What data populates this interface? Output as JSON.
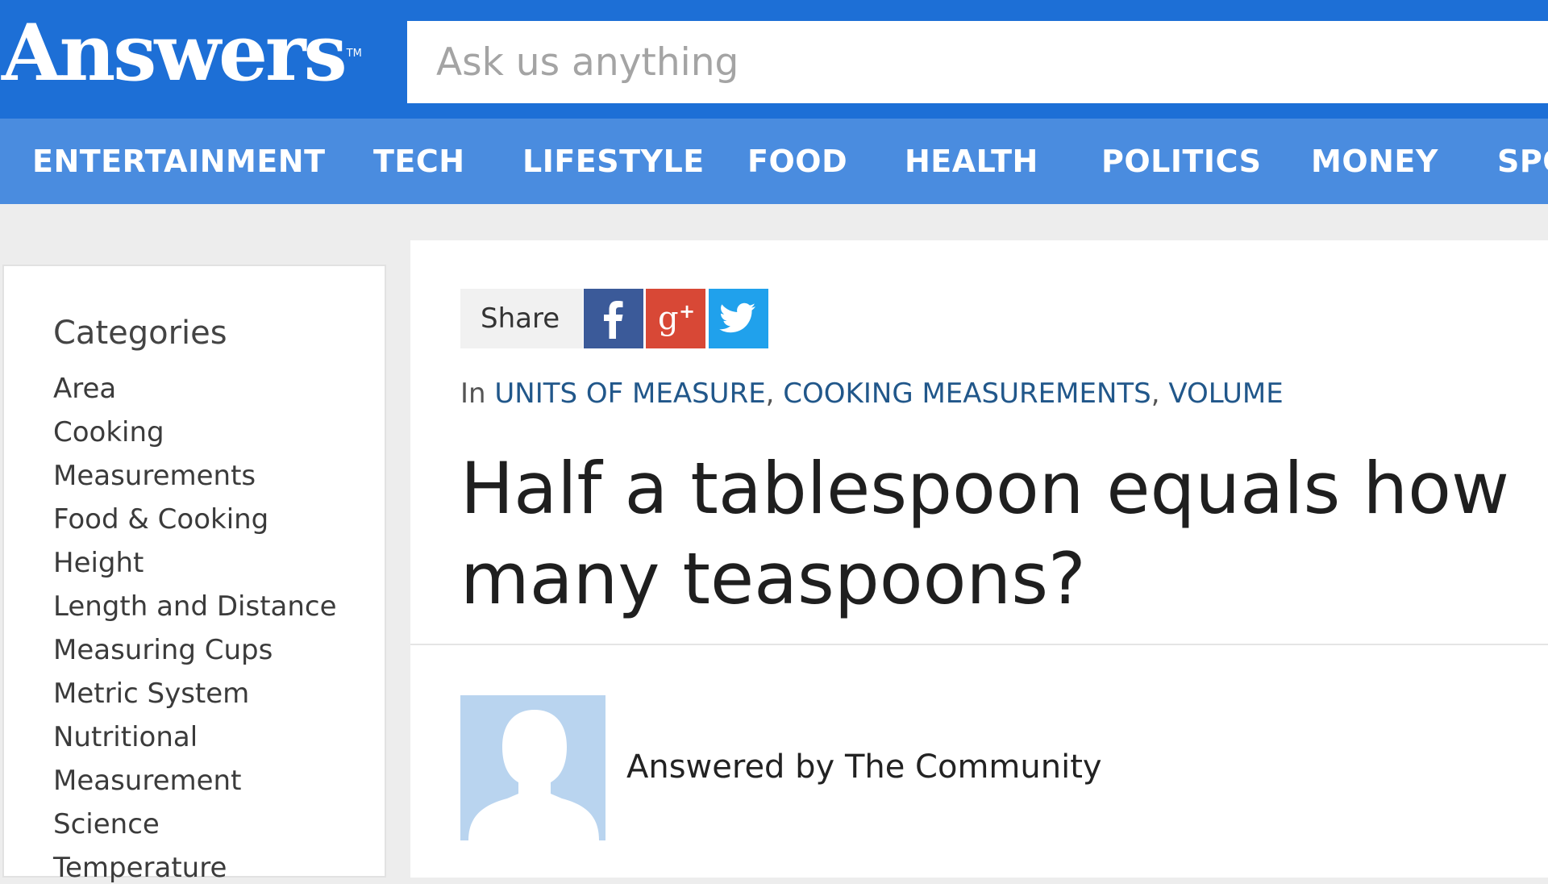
{
  "header": {
    "logo_text": "Answers",
    "logo_tm": "TM",
    "search_placeholder": "Ask us anything"
  },
  "nav": {
    "items": [
      "ENTERTAINMENT",
      "TECH",
      "LIFESTYLE",
      "FOOD",
      "HEALTH",
      "POLITICS",
      "MONEY",
      "SPO"
    ]
  },
  "sidebar": {
    "heading": "Categories",
    "items": [
      "Area",
      "Cooking",
      "Measurements",
      "Food & Cooking",
      "Height",
      "Length and Distance",
      "Measuring Cups",
      "Metric System",
      "Nutritional",
      "Measurement",
      "Science",
      "Temperature"
    ]
  },
  "main": {
    "share_label": "Share",
    "social_icons": [
      "facebook-icon",
      "google-plus-icon",
      "twitter-icon"
    ],
    "breadcrumb": {
      "prefix": "In",
      "categories": [
        "UNITS OF MEASURE",
        "COOKING MEASUREMENTS",
        "VOLUME"
      ],
      "separator": ","
    },
    "question_title": "Half a tablespoon equals how many teaspoons?",
    "answered_by": "Answered by The Community"
  },
  "colors": {
    "header_blue": "#1d6fd6",
    "nav_blue": "#4a8cdf",
    "link_blue": "#21578a",
    "facebook": "#3b5a99",
    "google_plus": "#d84836",
    "twitter": "#20a1ec",
    "avatar_bg": "#b9d4ef"
  }
}
